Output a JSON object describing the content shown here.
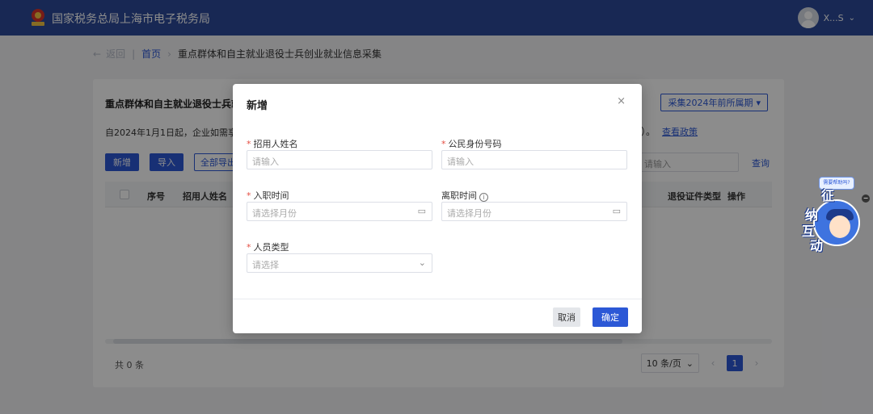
{
  "header": {
    "brand": "国家税务总局上海市电子税务局",
    "username": "X...S",
    "user_chevron": "⌄"
  },
  "breadcrumb": {
    "back_label": "返回",
    "home": "首页",
    "separator": "›",
    "current": "重点群体和自主就业退役士兵创业就业信息采集"
  },
  "card": {
    "title": "重点群体和自主就业退役士兵就",
    "period_button": "采集2024年前所属期",
    "notice": "自2024年1月1日起，企业如需享受",
    "notice_tail": "）。",
    "policy_link": "查看政策",
    "buttons": {
      "add": "新增",
      "import": "导入",
      "export_all": "全部导出"
    },
    "search_placeholder": "请输入",
    "query": "查询",
    "columns": [
      "序号",
      "招用人姓名",
      "退役证件类型",
      "操作"
    ],
    "total": "共 0 条",
    "page_size": "10 条/页",
    "current_page": "1"
  },
  "modal": {
    "title": "新增",
    "close": "×",
    "fields": {
      "name": {
        "label": "招用人姓名",
        "placeholder": "请输入"
      },
      "id_number": {
        "label": "公民身份号码",
        "placeholder": "请输入"
      },
      "hire_date": {
        "label": "入职时间",
        "placeholder": "请选择月份"
      },
      "leave_date": {
        "label": "离职时间",
        "placeholder": "请选择月份"
      },
      "person_type": {
        "label": "人员类型",
        "placeholder": "请选择"
      }
    },
    "required_mark": "*",
    "info_mark": "i",
    "cancel": "取消",
    "confirm": "确定"
  },
  "widget": {
    "bubble": "需要帮助吗?",
    "chars": [
      "征",
      "纳",
      "互",
      "动"
    ],
    "minimize": "−"
  },
  "colors": {
    "header_bg": "#2c4a9a",
    "primary": "#2c58d6",
    "required": "#e54d42"
  }
}
